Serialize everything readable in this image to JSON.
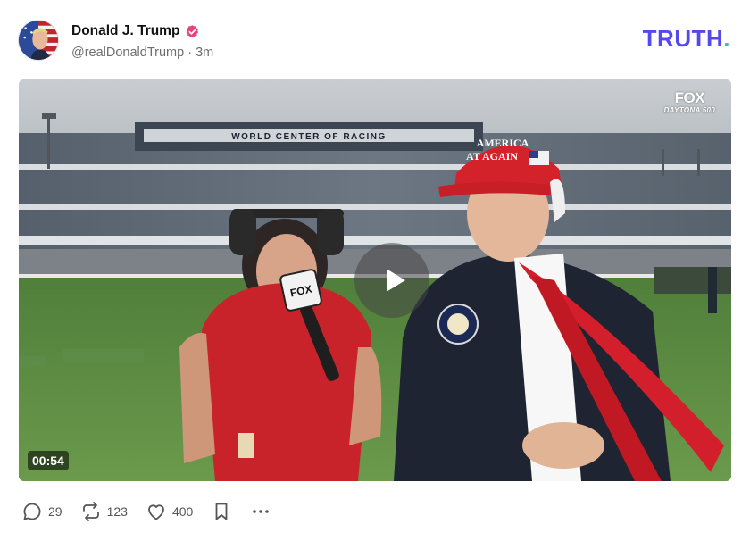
{
  "author": {
    "display_name": "Donald J. Trump",
    "handle": "@realDonaldTrump",
    "separator": "·",
    "time_ago": "3m",
    "verified": true
  },
  "brand": {
    "logo_text": "TRUTH",
    "logo_dot": ".",
    "logo_color": "#5448ee",
    "dot_color": "#26c6a8"
  },
  "video": {
    "duration": "00:54",
    "broadcaster_logo": "FOX",
    "broadcaster_sub": "DAYTONA 500",
    "stadium_sign": "WORLD CENTER OF RACING",
    "hat_text_line1": "AMERICA",
    "hat_text_line2": "AT AGAIN",
    "mic_flag": "FOX"
  },
  "actions": {
    "replies": "29",
    "retruths": "123",
    "likes": "400"
  },
  "icons": {
    "reply": "reply-icon",
    "retruth": "retruth-icon",
    "like": "heart-icon",
    "bookmark": "bookmark-icon",
    "more": "more-icon",
    "verified": "verified-badge-icon",
    "play": "play-icon"
  }
}
